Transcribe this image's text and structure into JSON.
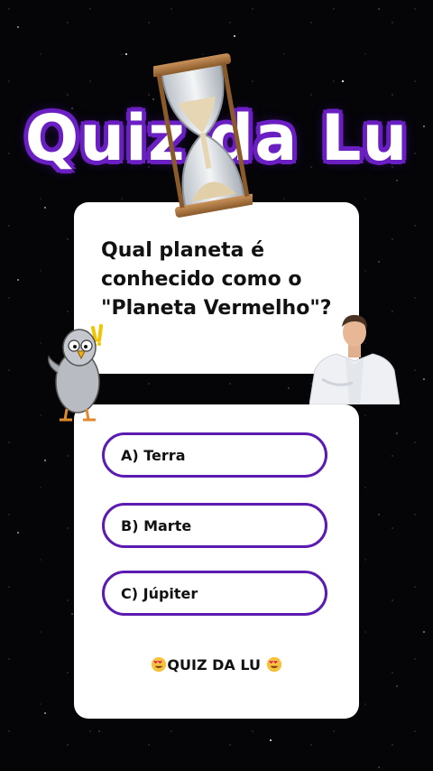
{
  "title": "Quiz da Lu",
  "question": "Qual planeta é conhecido como o \"Planeta Vermelho\"?",
  "options": [
    {
      "label": "A) Terra"
    },
    {
      "label": "B) Marte"
    },
    {
      "label": "C) Júpiter"
    }
  ],
  "footer": {
    "text": "QUIZ DA LU",
    "emoji": "heart-eyes-emoji"
  },
  "colors": {
    "accent": "#5b1ab0",
    "title_outline": "#6a1fc2",
    "card": "#ffffff",
    "background": "#050508"
  },
  "icons": {
    "hourglass": "hourglass-icon",
    "mascot": "pigeon-mascot",
    "presenter": "presenter-avatar"
  }
}
